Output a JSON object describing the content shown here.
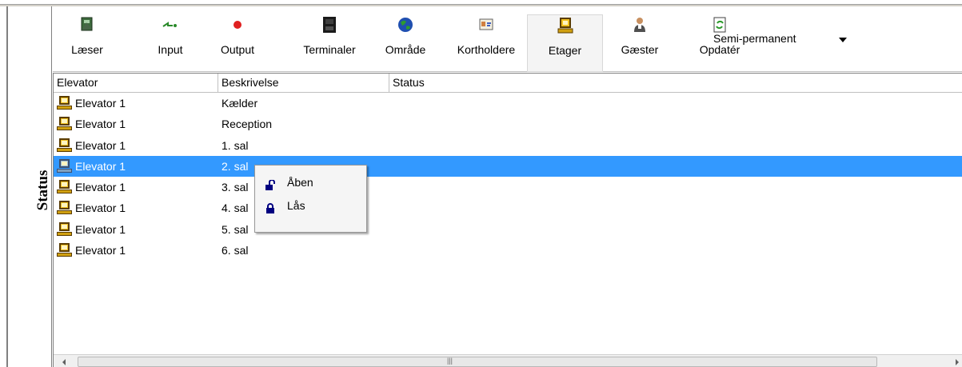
{
  "side_panel": {
    "title": "Status"
  },
  "toolbar": {
    "buttons": [
      {
        "label": "Læser",
        "icon": "reader-icon"
      },
      {
        "label": "Input",
        "icon": "input-icon"
      },
      {
        "label": "Output",
        "icon": "output-icon"
      },
      {
        "label": "Terminaler",
        "icon": "terminal-icon"
      },
      {
        "label": "Område",
        "icon": "globe-icon"
      },
      {
        "label": "Kortholdere",
        "icon": "cardholder-icon"
      },
      {
        "label": "Etager",
        "icon": "elevator-icon",
        "active": true
      },
      {
        "label": "Gæster",
        "icon": "guest-icon"
      },
      {
        "label": "Opdatér",
        "icon": "refresh-icon"
      }
    ],
    "mode_select": {
      "value": "Semi-permanent"
    }
  },
  "list": {
    "columns": [
      "Elevator",
      "Beskrivelse",
      "Status"
    ],
    "rows": [
      {
        "elevator": "Elevator 1",
        "description": "Kælder",
        "status": ""
      },
      {
        "elevator": "Elevator 1",
        "description": "Reception",
        "status": ""
      },
      {
        "elevator": "Elevator 1",
        "description": "1. sal",
        "status": ""
      },
      {
        "elevator": "Elevator 1",
        "description": "2. sal",
        "status": "",
        "selected": true
      },
      {
        "elevator": "Elevator 1",
        "description": "3. sal",
        "status": ""
      },
      {
        "elevator": "Elevator 1",
        "description": "4. sal",
        "status": ""
      },
      {
        "elevator": "Elevator 1",
        "description": "5. sal",
        "status": ""
      },
      {
        "elevator": "Elevator 1",
        "description": "6. sal",
        "status": ""
      }
    ]
  },
  "context_menu": {
    "items": [
      {
        "label": "Åben",
        "icon": "unlock-icon"
      },
      {
        "label": "Lås",
        "icon": "lock-icon"
      }
    ]
  },
  "colors": {
    "selection": "#3399ff",
    "elevator_icon": "#f0c020",
    "output_dot": "#e02020"
  }
}
